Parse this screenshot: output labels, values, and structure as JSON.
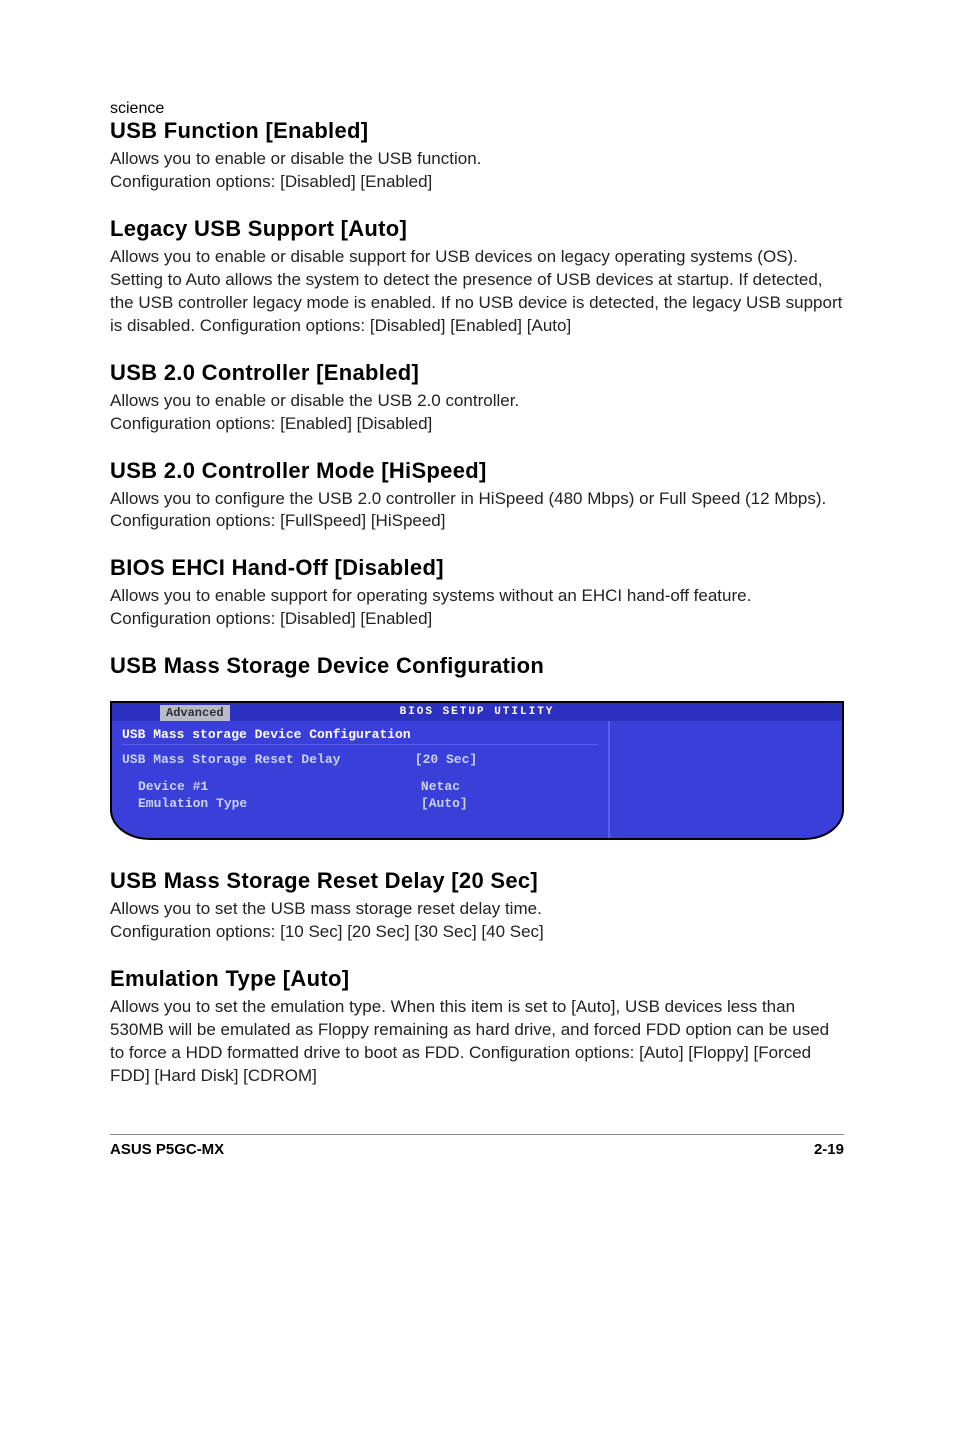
{
  "sections": {
    "usb_function": {
      "heading": "USB Function [Enabled]",
      "body": "Allows you to enable or disable the USB function.\nConfiguration options: [Disabled] [Enabled]"
    },
    "legacy_usb": {
      "heading": "Legacy USB Support [Auto]",
      "body": "Allows you to enable or disable support for USB devices on legacy operating systems (OS). Setting to Auto allows the system to detect the presence of USB devices at startup. If detected, the USB controller legacy mode is enabled. If no USB device is detected, the legacy USB support is disabled. Configuration options: [Disabled] [Enabled] [Auto]"
    },
    "usb20_ctrl": {
      "heading": "USB 2.0 Controller [Enabled]",
      "body": "Allows you to enable or disable the USB 2.0 controller.\nConfiguration options: [Enabled] [Disabled]"
    },
    "usb20_mode": {
      "heading": "USB 2.0 Controller Mode [HiSpeed]",
      "body": "Allows you to configure the USB 2.0 controller in HiSpeed (480 Mbps) or Full Speed (12 Mbps). Configuration options: [FullSpeed] [HiSpeed]"
    },
    "ehci": {
      "heading": "BIOS EHCI Hand-Off [Disabled]",
      "body": "Allows you to enable support for operating systems without an EHCI hand-off feature. Configuration options: [Disabled] [Enabled]"
    },
    "mass_storage_cfg": {
      "heading": "USB Mass Storage Device Configuration"
    },
    "reset_delay": {
      "heading": "USB Mass Storage Reset Delay [20 Sec]",
      "body": "Allows you to set the USB mass storage reset delay time.\nConfiguration options: [10 Sec] [20 Sec] [30 Sec] [40 Sec]"
    },
    "emulation": {
      "heading": "Emulation Type [Auto]",
      "body": "Allows you to set the emulation type. When this item is set to [Auto], USB devices less than 530MB will be emulated as Floppy remaining as hard drive, and forced FDD option can be used to force a HDD formatted drive to boot as FDD. Configuration options: [Auto] [Floppy] [Forced FDD] [Hard Disk] [CDROM]"
    }
  },
  "bios": {
    "titlebar": "BIOS SETUP UTILITY",
    "tab": "Advanced",
    "panel_title": "USB Mass storage Device Configuration",
    "rows": {
      "reset_delay_label": "USB Mass Storage Reset Delay",
      "reset_delay_value": "[20 Sec]",
      "device_label": "Device #1",
      "device_value": "Netac",
      "emulation_label": "Emulation Type",
      "emulation_value": "[Auto]"
    }
  },
  "footer": {
    "left": "ASUS P5GC-MX",
    "right": "2-19"
  }
}
